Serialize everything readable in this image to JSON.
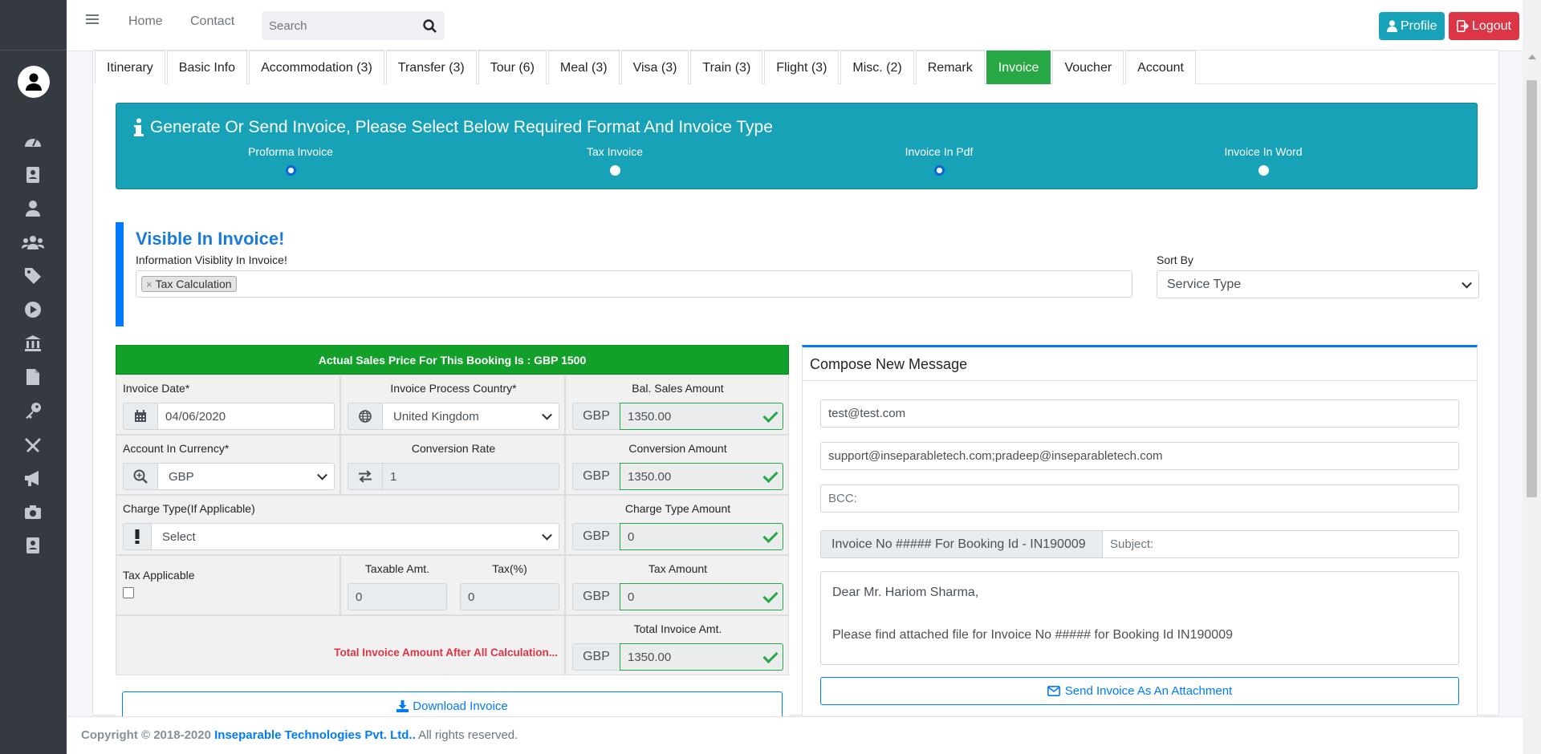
{
  "topbar": {
    "home": "Home",
    "contact": "Contact",
    "search_placeholder": "Search",
    "profile": "Profile",
    "logout": "Logout"
  },
  "tabs": [
    {
      "label": "Itinerary"
    },
    {
      "label": "Basic Info"
    },
    {
      "label": "Accommodation (3)"
    },
    {
      "label": "Transfer (3)"
    },
    {
      "label": "Tour (6)"
    },
    {
      "label": "Meal (3)"
    },
    {
      "label": "Visa (3)"
    },
    {
      "label": "Train (3)"
    },
    {
      "label": "Flight (3)"
    },
    {
      "label": "Misc. (2)"
    },
    {
      "label": "Remark"
    },
    {
      "label": "Invoice",
      "active": true
    },
    {
      "label": "Voucher"
    },
    {
      "label": "Account"
    }
  ],
  "banner": {
    "title": "Generate Or Send Invoice, Please Select Below Required Format And Invoice Type",
    "options": [
      {
        "label": "Proforma Invoice",
        "checked": true
      },
      {
        "label": "Tax Invoice",
        "checked": false
      },
      {
        "label": "Invoice In Pdf",
        "checked": true
      },
      {
        "label": "Invoice In Word",
        "checked": false
      }
    ]
  },
  "visibility": {
    "heading": "Visible In Invoice!",
    "info_label": "Information Visiblity In Invoice!",
    "tag": "Tax Calculation",
    "sort_label": "Sort By",
    "sort_value": "Service Type"
  },
  "calc": {
    "header": "Actual Sales Price For This Booking Is : GBP 1500",
    "invoice_date_label": "Invoice Date*",
    "invoice_date": "04/06/2020",
    "country_label": "Invoice Process Country*",
    "country": "United Kingdom",
    "bal_label": "Bal. Sales Amount",
    "currency": "GBP",
    "bal_value": "1350.00",
    "acc_currency_label": "Account In Currency*",
    "acc_currency": "GBP",
    "conv_rate_label": "Conversion Rate",
    "conv_rate": "1",
    "conv_amount_label": "Conversion Amount",
    "conv_amount": "1350.00",
    "charge_type_label": "Charge Type(If Applicable)",
    "charge_type": "Select",
    "charge_amount_label": "Charge Type Amount",
    "charge_amount": "0",
    "tax_applicable_label": "Tax Applicable",
    "taxable_label": "Taxable Amt.",
    "taxable_value": "0",
    "tax_pct_label": "Tax(%)",
    "tax_pct_value": "0",
    "tax_amount_label": "Tax Amount",
    "tax_amount": "0",
    "total_label": "Total Invoice Amt.",
    "total_note": "Total Invoice Amount After All Calculation...",
    "total_value": "1350.00",
    "download": "Download Invoice"
  },
  "compose": {
    "title": "Compose New Message",
    "to": "test@test.com",
    "cc": "support@inseparabletech.com;pradeep@inseparabletech.com",
    "bcc_placeholder": "BCC:",
    "subject_prefix": "Invoice No ##### For Booking Id - IN190009",
    "subject_placeholder": "Subject:",
    "message_line1": "Dear Mr. Hariom Sharma,",
    "message_line2": "Please find attached file for Invoice No ##### for Booking Id IN190009",
    "send": "Send Invoice As An Attachment"
  },
  "footer": {
    "copyright": "Copyright © 2018-2020",
    "brand": "Inseparable Technologies Pvt. Ltd..",
    "rights": "All rights reserved."
  },
  "colors": {
    "sidebar": "#343a40",
    "banner": "#17a2b8",
    "active_tab": "#28a745",
    "header_green": "#12a02b",
    "primary": "#007bff",
    "danger": "#dc3545"
  }
}
